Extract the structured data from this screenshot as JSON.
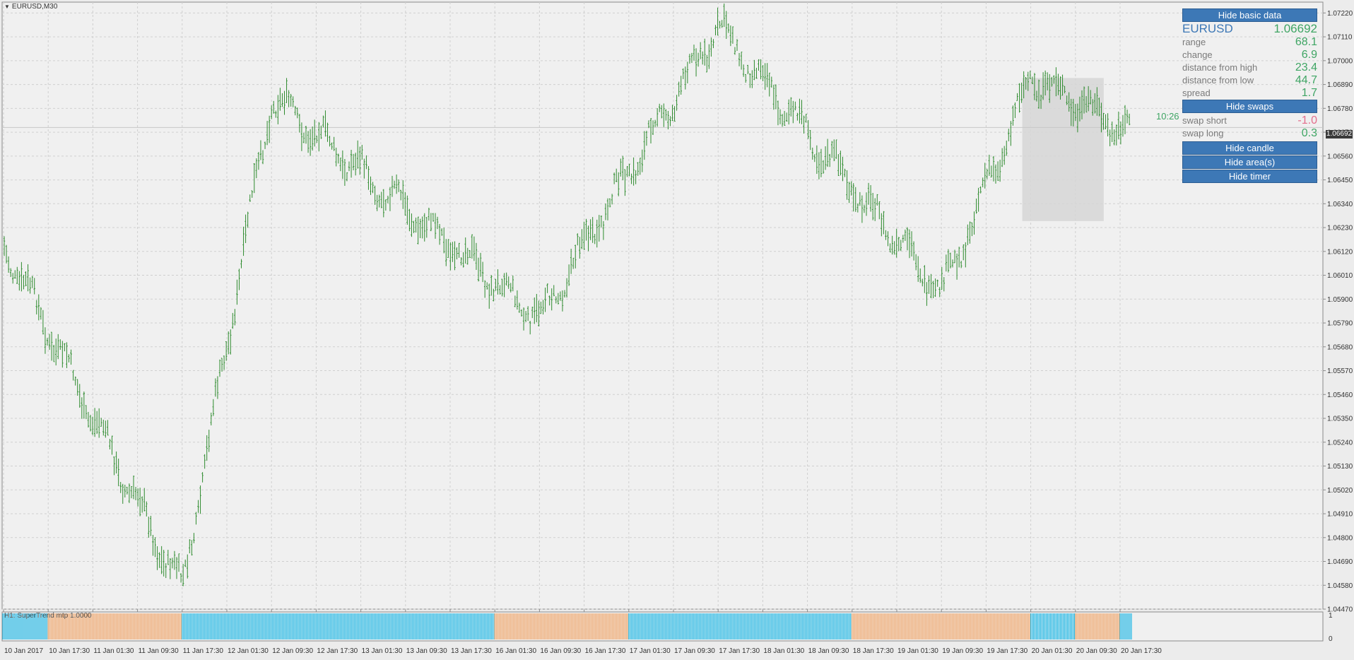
{
  "window": {
    "title": "EURUSD,M30"
  },
  "indicator": {
    "label": "H1: SuperTrend mtp 1.0000",
    "scale_top": "1",
    "scale_bottom": "0"
  },
  "price_axis": {
    "labels": [
      "1.07220",
      "1.07110",
      "1.07000",
      "1.06890",
      "1.06780",
      "1.06670",
      "1.06560",
      "1.06450",
      "1.06340",
      "1.06230",
      "1.06120",
      "1.06010",
      "1.05900",
      "1.05790",
      "1.05680",
      "1.05570",
      "1.05460",
      "1.05350",
      "1.05240",
      "1.05130",
      "1.05020",
      "1.04910",
      "1.04800",
      "1.04690",
      "1.04580",
      "1.04470"
    ],
    "current_badge": "1.06692"
  },
  "time_axis": {
    "labels": [
      "10 Jan 2017",
      "10 Jan 17:30",
      "11 Jan 01:30",
      "11 Jan 09:30",
      "11 Jan 17:30",
      "12 Jan 01:30",
      "12 Jan 09:30",
      "12 Jan 17:30",
      "13 Jan 01:30",
      "13 Jan 09:30",
      "13 Jan 17:30",
      "16 Jan 01:30",
      "16 Jan 09:30",
      "16 Jan 17:30",
      "17 Jan 01:30",
      "17 Jan 09:30",
      "17 Jan 17:30",
      "18 Jan 01:30",
      "18 Jan 09:30",
      "18 Jan 17:30",
      "19 Jan 01:30",
      "19 Jan 09:30",
      "19 Jan 17:30",
      "20 Jan 01:30",
      "20 Jan 09:30",
      "20 Jan 17:30"
    ]
  },
  "panel": {
    "hide_basic": "Hide basic data",
    "symbol": "EURUSD",
    "price": "1.06692",
    "range_label": "range",
    "range_value": "68.1",
    "change_label": "change",
    "change_value": "6.9",
    "dist_high_label": "distance from high",
    "dist_high_value": "23.4",
    "dist_low_label": "distance from low",
    "dist_low_value": "44.7",
    "spread_label": "spread",
    "spread_value": "1.7",
    "hide_swaps": "Hide swaps",
    "swap_short_label": "swap short",
    "swap_short_value": "-1.0",
    "swap_long_label": "swap long",
    "swap_long_value": "0.3",
    "hide_candle": "Hide candle",
    "hide_areas": "Hide area(s)",
    "hide_timer": "Hide timer"
  },
  "timer": "10:26",
  "colors": {
    "bar": "#2e8b2e",
    "up_trend": "#1fb8e6",
    "down_trend": "#f0a468",
    "button": "#3d78b6",
    "green_value": "#3fa564",
    "pink_value": "#e36e8c"
  },
  "chart_data": {
    "type": "bar",
    "symbol": "EURUSD",
    "timeframe": "M30",
    "ylim": [
      1.0447,
      1.0727
    ],
    "key_levels": [
      {
        "time": "10 Jan 2017",
        "price": 1.0615
      },
      {
        "time": "11 Jan 17:30",
        "price": 1.0456
      },
      {
        "time": "12 Jan 09:30",
        "price": 1.0683
      },
      {
        "time": "16 Jan 09:30",
        "price": 1.0581
      },
      {
        "time": "17 Jan 17:30",
        "price": 1.0716
      },
      {
        "time": "19 Jan 09:30",
        "price": 1.0592
      },
      {
        "time": "20 Jan 01:30",
        "price": 1.0692
      },
      {
        "time": "20 Jan 17:30",
        "price": 1.0669
      }
    ],
    "current_price": 1.06692,
    "supertrend_segments": [
      {
        "trend": "up",
        "from": "10 Jan 2017",
        "to": "10 Jan 17:30"
      },
      {
        "trend": "down",
        "from": "10 Jan 17:30",
        "to": "11 Jan 17:30"
      },
      {
        "trend": "up",
        "from": "11 Jan 17:30",
        "to": "16 Jan 01:30"
      },
      {
        "trend": "down",
        "from": "16 Jan 01:30",
        "to": "17 Jan 01:30"
      },
      {
        "trend": "up",
        "from": "17 Jan 01:30",
        "to": "18 Jan 17:30"
      },
      {
        "trend": "down",
        "from": "18 Jan 17:30",
        "to": "20 Jan 01:30"
      },
      {
        "trend": "up",
        "from": "20 Jan 01:30",
        "to": "20 Jan 09:30"
      },
      {
        "trend": "down",
        "from": "20 Jan 09:30",
        "to": "20 Jan 17:30"
      },
      {
        "trend": "up",
        "from": "20 Jan 17:30",
        "to": "20 Jan 17:30"
      }
    ]
  }
}
